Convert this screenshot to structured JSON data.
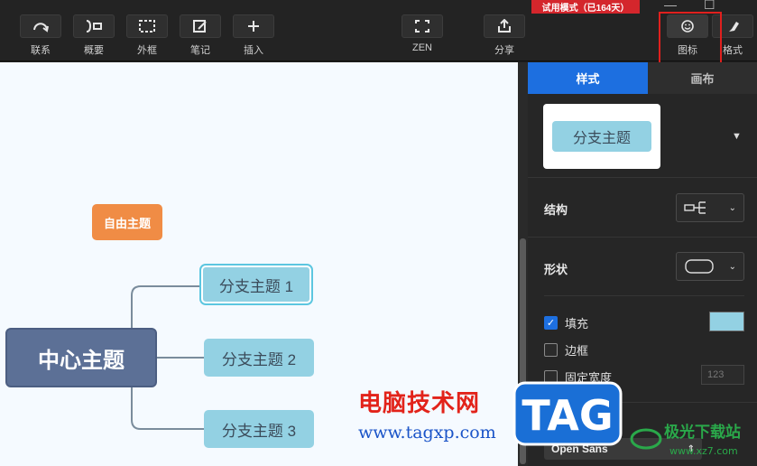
{
  "toolbar": {
    "items": [
      {
        "label": "联系",
        "icon": "relation-icon"
      },
      {
        "label": "概要",
        "icon": "summary-icon"
      },
      {
        "label": "外框",
        "icon": "boundary-icon"
      },
      {
        "label": "笔记",
        "icon": "note-icon"
      },
      {
        "label": "插入",
        "icon": "insert-icon"
      },
      {
        "label": "ZEN",
        "icon": "zen-icon"
      },
      {
        "label": "分享",
        "icon": "share-icon"
      }
    ],
    "trial_badge": "试用模式（已164天）",
    "icon_tab": {
      "label": "图标",
      "icon": "smiley-icon"
    },
    "format_tab": {
      "label": "格式",
      "icon": "brush-icon"
    },
    "highlight_color": "#e0201e"
  },
  "canvas": {
    "central_topic": "中心主题",
    "free_topic": "自由主题",
    "branches": [
      "分支主题 1",
      "分支主题 2",
      "分支主题 3"
    ],
    "colors": {
      "central": "#5c7096",
      "branch": "#93d1e3",
      "free": "#f08c45",
      "background": "#f5faff"
    }
  },
  "panel": {
    "tabs": [
      "样式",
      "画布"
    ],
    "active_tab": "样式",
    "style_preview": "分支主题",
    "structure_label": "结构",
    "shape_label": "形状",
    "fill_label": "填充",
    "fill_checked": true,
    "fill_color": "#93d1e3",
    "border_label": "边框",
    "border_checked": false,
    "fixed_width_label": "固定宽度",
    "fixed_width_checked": false,
    "fixed_width_placeholder": "123",
    "font_value": "Open Sans",
    "accent": "#1d6fe0"
  },
  "watermark": {
    "site_name": "电脑技术网",
    "site_url": "www.tagxp.com",
    "logo_text": "TAG",
    "site2_name": "极光下载站",
    "site2_url": "www.xz7.com"
  }
}
